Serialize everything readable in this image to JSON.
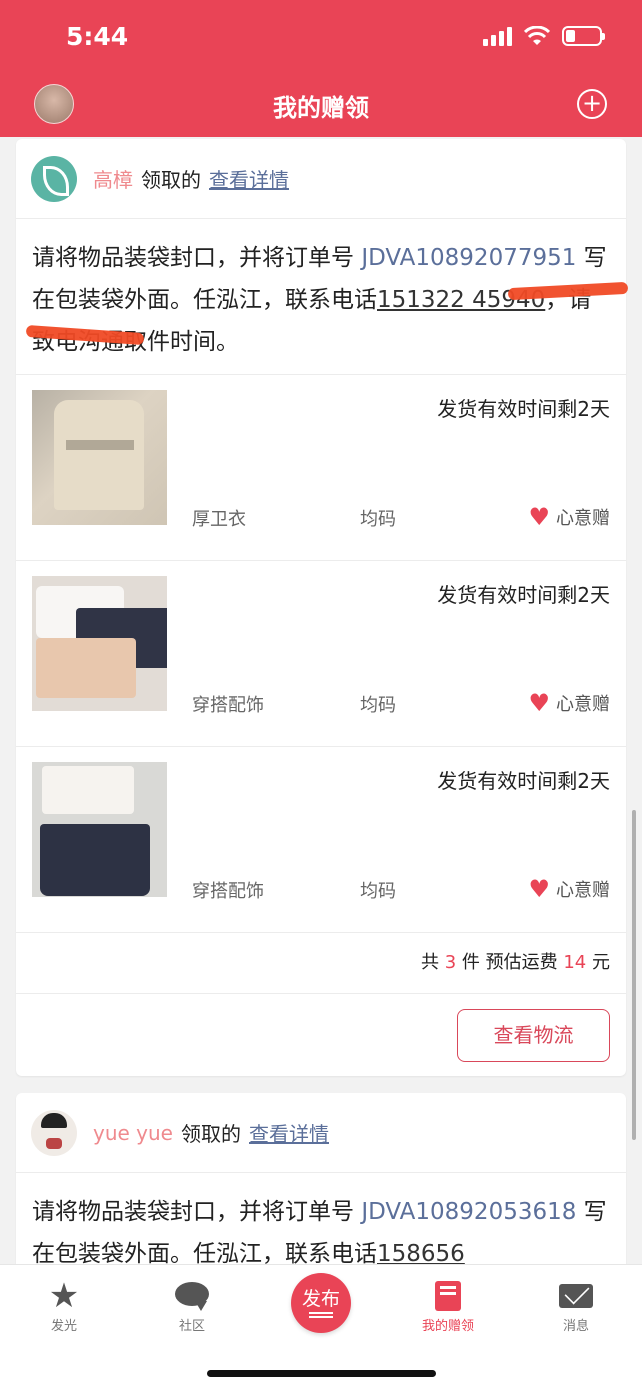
{
  "status_bar": {
    "time": "5:44"
  },
  "header": {
    "title": "我的赠领",
    "add_icon": "plus-circle-icon"
  },
  "cards": [
    {
      "claimer": "高樟",
      "claim_label": "领取的",
      "detail_link": "查看详情",
      "instruction": {
        "prefix": "请将物品装袋封口，并将订单号 ",
        "order_no": "JDVA10892077951",
        "middle": " 写在包装袋外面。任泓江，联系电话",
        "phone": "151322 45940",
        "suffix": "，请致电沟通取件时间。"
      },
      "items": [
        {
          "timer": "发货有效时间剩2天",
          "category": "厚卫衣",
          "size": "均码",
          "mode": "心意赠"
        },
        {
          "timer": "发货有效时间剩2天",
          "category": "穿搭配饰",
          "size": "均码",
          "mode": "心意赠"
        },
        {
          "timer": "发货有效时间剩2天",
          "category": "穿搭配饰",
          "size": "均码",
          "mode": "心意赠"
        }
      ],
      "summary": {
        "prefix": "共 ",
        "count": "3",
        "middle": " 件 预估运费 ",
        "fee": "14",
        "suffix": " 元"
      },
      "logistics_button": "查看物流"
    },
    {
      "claimer": "yue yue",
      "claim_label": "领取的",
      "detail_link": "查看详情",
      "instruction": {
        "prefix": "请将物品装袋封口，并将订单号 ",
        "order_no": "JDVA10892053618",
        "middle": " 写在包装袋外面。任泓江，联系电话",
        "phone": "158656"
      }
    }
  ],
  "tabbar": [
    {
      "label": "发光",
      "icon": "star-icon"
    },
    {
      "label": "社区",
      "icon": "chat-bubble-icon"
    },
    {
      "label": "发布",
      "icon": "publish-icon"
    },
    {
      "label": "我的赠领",
      "icon": "gift-book-icon",
      "active": true
    },
    {
      "label": "消息",
      "icon": "mail-icon"
    }
  ],
  "colors": {
    "brand": "#e94456",
    "link": "#5b6f9a",
    "claimer": "#ef8a8e"
  }
}
